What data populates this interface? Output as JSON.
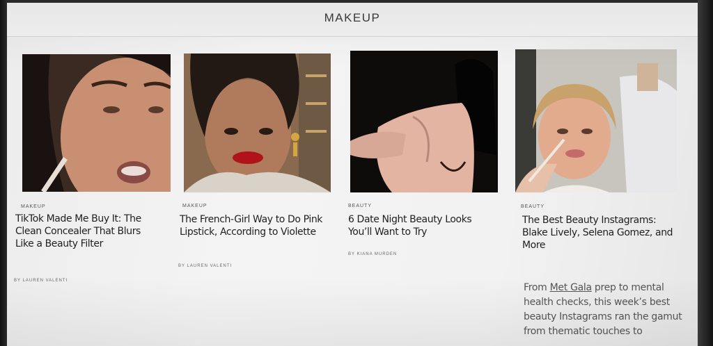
{
  "section": {
    "title": "MAKEUP"
  },
  "articles": [
    {
      "category": "MAKEUP",
      "headline": "TikTok Made Me Buy It: The Clean Concealer That Blurs Like a Beauty Filter",
      "byline": "BY LAUREN VALENTI"
    },
    {
      "category": "MAKEUP",
      "headline": "The French-Girl Way to Do Pink Lipstick, According to Violette",
      "byline": "BY LAUREN VALENTI"
    },
    {
      "category": "BEAUTY",
      "headline": "6 Date Night Beauty Looks You’ll Want to Try",
      "byline": "BY KIANA MURDEN"
    },
    {
      "category": "BEAUTY",
      "headline": "The Best Beauty Instagrams: Blake Lively, Selena Gomez, and More",
      "dek_lead": "From ",
      "dek_link": "Met Gala",
      "dek_rest": " prep to mental health checks, this week’s best beauty Instagrams ran the gamut from thematic touches to"
    }
  ]
}
